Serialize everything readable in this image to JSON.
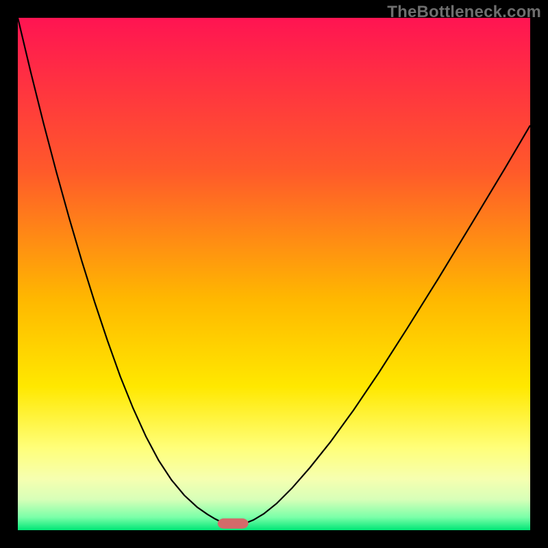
{
  "watermark": "TheBottleneck.com",
  "chart_data": {
    "type": "line",
    "title": "",
    "xlabel": "",
    "ylabel": "",
    "xlim": [
      0,
      100
    ],
    "ylim": [
      0,
      100
    ],
    "gradient_stops": [
      {
        "offset": 0.0,
        "color": "#ff1452"
      },
      {
        "offset": 0.3,
        "color": "#ff5a2a"
      },
      {
        "offset": 0.55,
        "color": "#ffb800"
      },
      {
        "offset": 0.72,
        "color": "#ffe800"
      },
      {
        "offset": 0.84,
        "color": "#ffff7a"
      },
      {
        "offset": 0.9,
        "color": "#f6ffb0"
      },
      {
        "offset": 0.94,
        "color": "#d7ffb8"
      },
      {
        "offset": 0.975,
        "color": "#7affa8"
      },
      {
        "offset": 1.0,
        "color": "#00e676"
      }
    ],
    "marker": {
      "x": 42,
      "y": 98.7,
      "w": 6,
      "h": 2,
      "color": "#d36a6a",
      "rx": 1.2
    },
    "series": [
      {
        "name": "left",
        "x": [
          0.0,
          2.5,
          5.0,
          7.5,
          10.0,
          12.5,
          15.0,
          17.5,
          20.0,
          22.5,
          25.0,
          27.5,
          30.0,
          32.5,
          35.0,
          37.0,
          38.5,
          39.5,
          40.3
        ],
        "y": [
          0.0,
          10.5,
          20.5,
          30.0,
          39.0,
          47.5,
          55.5,
          63.0,
          70.0,
          76.2,
          81.7,
          86.4,
          90.2,
          93.2,
          95.5,
          96.9,
          97.8,
          98.3,
          98.6
        ]
      },
      {
        "name": "right",
        "x": [
          44.5,
          46.0,
          48.0,
          50.5,
          53.5,
          57.0,
          61.0,
          65.5,
          70.5,
          76.0,
          82.0,
          88.5,
          95.0,
          100.0
        ],
        "y": [
          98.6,
          98.0,
          96.8,
          94.8,
          91.8,
          87.8,
          82.8,
          76.6,
          69.2,
          60.6,
          51.0,
          40.3,
          29.5,
          21.0
        ]
      }
    ]
  }
}
